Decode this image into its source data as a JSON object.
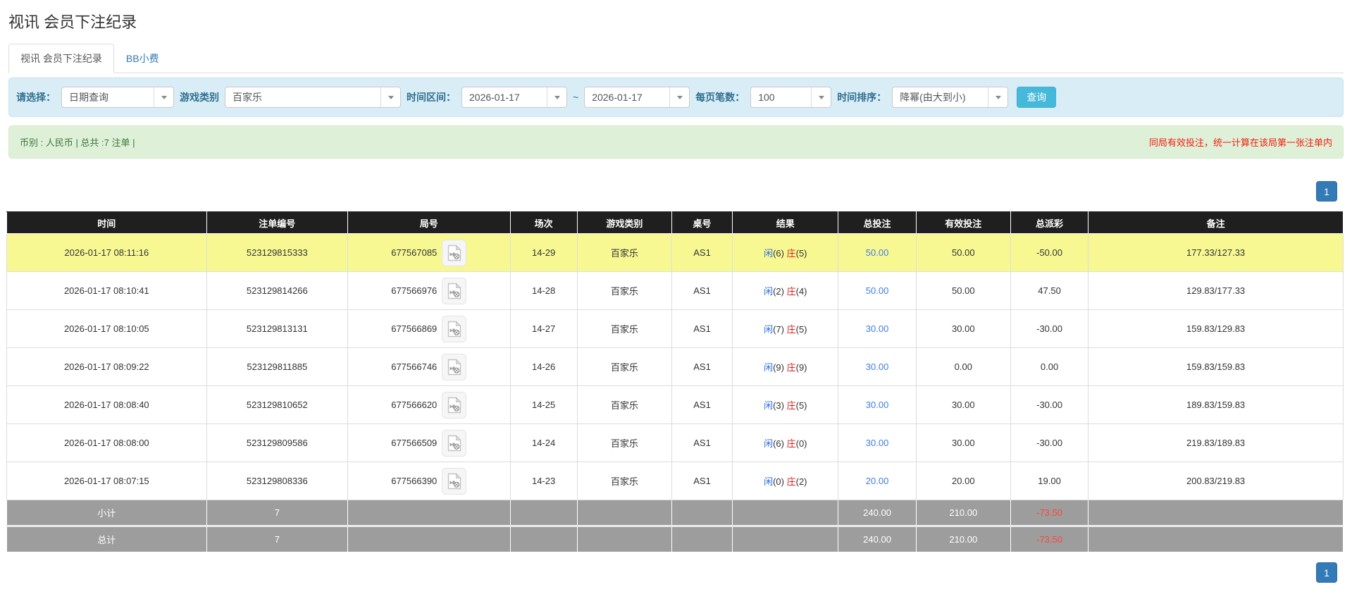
{
  "page": {
    "title": "视讯 会员下注纪录"
  },
  "tabs": [
    {
      "label": "视讯 会员下注纪录",
      "active": true
    },
    {
      "label": "BB小费",
      "active": false
    }
  ],
  "filters": {
    "choose_label": "请选择：",
    "choose_value": "日期查询",
    "game_label": "游戏类别",
    "game_value": "百家乐",
    "range_label": "时间区间：",
    "date_from": "2026-01-17",
    "range_separator": "~",
    "date_to": "2026-01-17",
    "per_page_label": "每页笔数：",
    "per_page_value": "100",
    "sort_label": "时间排序：",
    "sort_value": "降幂(由大到小)",
    "query_button": "查询"
  },
  "summary": {
    "left": "币别 : 人民币 | 总共 :7 注单 |",
    "right_notice": "同局有效投注，统一计算在该局第一张注单内"
  },
  "pagination": {
    "page": "1"
  },
  "icons": {
    "dropdown": "caret-down-icon",
    "replay": "video-file-icon"
  },
  "colors": {
    "accent_blue": "#337ab7",
    "query_button": "#46b8da",
    "filter_bg": "#d9edf7",
    "summary_bg": "#dff0d8",
    "notice_red": "#f21d0d",
    "highlight_row": "#f8f893",
    "header_bg": "#1f1f1f",
    "footer_bg": "#9d9d9d",
    "amount_link_blue": "#3f7de0",
    "player_blue": "#2f6de0",
    "banker_red": "#e01b1b",
    "negative_red": "#ee0000"
  },
  "table": {
    "headers": [
      "时间",
      "注单编号",
      "局号",
      "场次",
      "游戏类别",
      "桌号",
      "结果",
      "总投注",
      "有效投注",
      "总派彩",
      "备注"
    ],
    "rows": [
      {
        "time": "2026-01-17 08:11:16",
        "bet_id": "523129815333",
        "round_id": "677567085",
        "session": "14-29",
        "game": "百家乐",
        "table_no": "AS1",
        "result": {
          "player": "闲",
          "player_num": "(6)",
          "banker": "庄",
          "banker_num": "(5)"
        },
        "total_bet": "50.00",
        "valid_bet": "50.00",
        "payout": "-50.00",
        "note": "177.33/127.33",
        "highlight": true
      },
      {
        "time": "2026-01-17 08:10:41",
        "bet_id": "523129814266",
        "round_id": "677566976",
        "session": "14-28",
        "game": "百家乐",
        "table_no": "AS1",
        "result": {
          "player": "闲",
          "player_num": "(2)",
          "banker": "庄",
          "banker_num": "(4)"
        },
        "total_bet": "50.00",
        "valid_bet": "50.00",
        "payout": "47.50",
        "note": "129.83/177.33",
        "highlight": false
      },
      {
        "time": "2026-01-17 08:10:05",
        "bet_id": "523129813131",
        "round_id": "677566869",
        "session": "14-27",
        "game": "百家乐",
        "table_no": "AS1",
        "result": {
          "player": "闲",
          "player_num": "(7)",
          "banker": "庄",
          "banker_num": "(5)"
        },
        "total_bet": "30.00",
        "valid_bet": "30.00",
        "payout": "-30.00",
        "note": "159.83/129.83",
        "highlight": false
      },
      {
        "time": "2026-01-17 08:09:22",
        "bet_id": "523129811885",
        "round_id": "677566746",
        "session": "14-26",
        "game": "百家乐",
        "table_no": "AS1",
        "result": {
          "player": "闲",
          "player_num": "(9)",
          "banker": "庄",
          "banker_num": "(9)"
        },
        "total_bet": "30.00",
        "valid_bet": "0.00",
        "payout": "0.00",
        "note": "159.83/159.83",
        "highlight": false
      },
      {
        "time": "2026-01-17 08:08:40",
        "bet_id": "523129810652",
        "round_id": "677566620",
        "session": "14-25",
        "game": "百家乐",
        "table_no": "AS1",
        "result": {
          "player": "闲",
          "player_num": "(3)",
          "banker": "庄",
          "banker_num": "(5)"
        },
        "total_bet": "30.00",
        "valid_bet": "30.00",
        "payout": "-30.00",
        "note": "189.83/159.83",
        "highlight": false
      },
      {
        "time": "2026-01-17 08:08:00",
        "bet_id": "523129809586",
        "round_id": "677566509",
        "session": "14-24",
        "game": "百家乐",
        "table_no": "AS1",
        "result": {
          "player": "闲",
          "player_num": "(6)",
          "banker": "庄",
          "banker_num": "(0)"
        },
        "total_bet": "30.00",
        "valid_bet": "30.00",
        "payout": "-30.00",
        "note": "219.83/189.83",
        "highlight": false
      },
      {
        "time": "2026-01-17 08:07:15",
        "bet_id": "523129808336",
        "round_id": "677566390",
        "session": "14-23",
        "game": "百家乐",
        "table_no": "AS1",
        "result": {
          "player": "闲",
          "player_num": "(0)",
          "banker": "庄",
          "banker_num": "(2)"
        },
        "total_bet": "20.00",
        "valid_bet": "20.00",
        "payout": "19.00",
        "note": "200.83/219.83",
        "highlight": false
      }
    ],
    "footer": [
      {
        "label": "小计",
        "count": "7",
        "total_bet": "240.00",
        "valid_bet": "210.00",
        "payout": "-73.50"
      },
      {
        "label": "总计",
        "count": "7",
        "total_bet": "240.00",
        "valid_bet": "210.00",
        "payout": "-73.50"
      }
    ]
  }
}
